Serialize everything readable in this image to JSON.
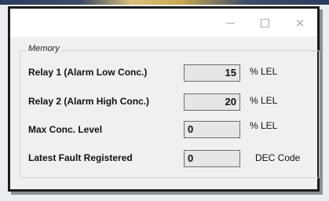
{
  "window": {
    "minimize_glyph": "minimize-icon",
    "maximize_glyph": "maximize-icon",
    "close_glyph": "×"
  },
  "memory": {
    "legend": "Memory",
    "rows": [
      {
        "label": "Relay 1 (Alarm Low Conc.)",
        "value": "15",
        "unit": "% LEL"
      },
      {
        "label": "Relay 2 (Alarm High Conc.)",
        "value": "20",
        "unit": "% LEL"
      },
      {
        "label": "Max Conc. Level",
        "value": "0",
        "unit": "% LEL"
      },
      {
        "label": "Latest Fault Registered",
        "value": "0",
        "unit": "DEC Code"
      }
    ]
  }
}
